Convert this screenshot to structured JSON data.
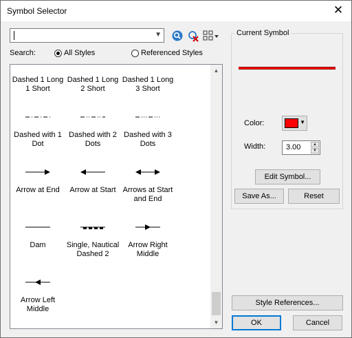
{
  "window": {
    "title": "Symbol Selector",
    "close_glyph": "✕"
  },
  "search": {
    "value": "",
    "label": "Search:",
    "options": [
      "All Styles",
      "Referenced Styles"
    ],
    "selected": "All Styles"
  },
  "symbols": [
    {
      "label": "Dashed 1 Long 1 Short",
      "style": "dash-1-1"
    },
    {
      "label": "Dashed 1 Long 2 Short",
      "style": "dash-1-2"
    },
    {
      "label": "Dashed 1 Long 3 Short",
      "style": "dash-1-3"
    },
    {
      "label": "Dashed with 1 Dot",
      "style": "dot-1"
    },
    {
      "label": "Dashed with 2 Dots",
      "style": "dot-2"
    },
    {
      "label": "Dashed with 3 Dots",
      "style": "dot-3"
    },
    {
      "label": "Arrow at End",
      "style": "arrow-end"
    },
    {
      "label": "Arrow at Start",
      "style": "arrow-start"
    },
    {
      "label": "Arrows at Start and End",
      "style": "arrow-both"
    },
    {
      "label": "Dam",
      "style": "solid"
    },
    {
      "label": "Single, Nautical Dashed 2",
      "style": "nautical"
    },
    {
      "label": "Arrow Right Middle",
      "style": "arrow-right-mid"
    },
    {
      "label": "Arrow Left Middle",
      "style": "arrow-left-mid"
    }
  ],
  "current_symbol": {
    "group_title": "Current Symbol",
    "color_label": "Color:",
    "color": "#ff0000",
    "width_label": "Width:",
    "width_value": "3.00",
    "edit_button": "Edit Symbol...",
    "save_button": "Save As...",
    "reset_button": "Reset"
  },
  "footer": {
    "style_refs_button": "Style References...",
    "ok_button": "OK",
    "cancel_button": "Cancel"
  }
}
